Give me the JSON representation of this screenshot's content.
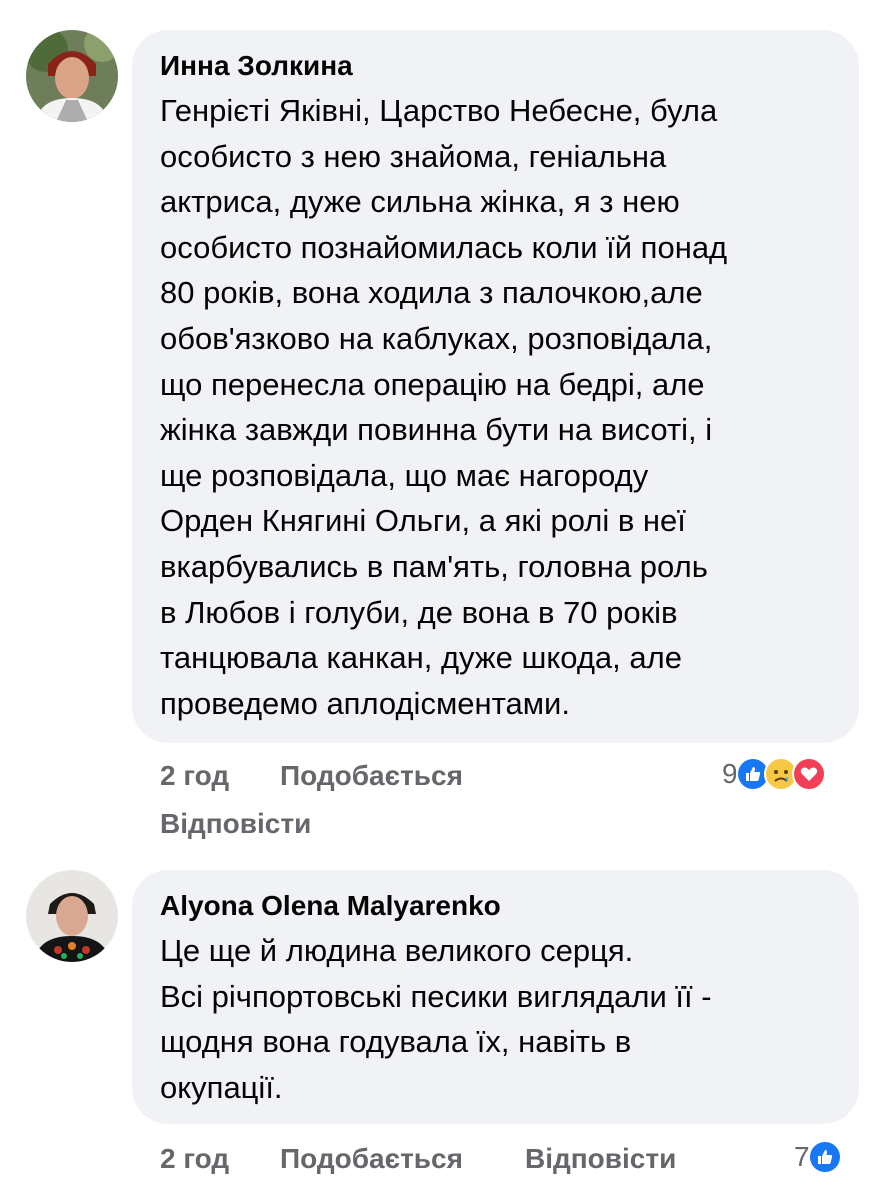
{
  "comments": [
    {
      "author": "Инна Золкина",
      "text": "Генрієті Яківні, Царство Небесне, була\nособисто з нею знайома, геніальна\nактриса, дуже сильна жінка, я з нею\nособисто познайомилась коли їй понад\n80 років, вона ходила з палочкою,але\nобов'язково на каблуках, розповідала,\nщо перенесла операцію на бедрі, але\nжінка завжди повинна бути на висоті, і\nще розповідала, що має нагороду\nОрден Княгині Ольги, а які ролі в неї\nвкарбувались в пам'ять, головна роль\nв Любов і голуби, де вона в 70 років\nтанцювала канкан, дуже шкода, але\nпроведемо аплодісментами.",
      "time": "2 год",
      "like_label": "Подобається",
      "reply_label": "Відповісти",
      "reaction_count": "9",
      "reactions": [
        "like-icon",
        "sad-icon",
        "love-icon"
      ]
    },
    {
      "author": "Alyona Olena Malyarenko",
      "text": "Це ще й людина великого серця.\nВсі річпортовські песики виглядали її -\nщодня вона годувала їх, навіть в\nокупації.",
      "time": "2 год",
      "like_label": "Подобається",
      "reply_label": "Відповісти",
      "reaction_count": "7",
      "reactions": [
        "like-icon"
      ]
    }
  ],
  "colors": {
    "bubble": "#f0f2f5",
    "meta_text": "#65676b",
    "like": "#1877f2",
    "sad": "#f7c845",
    "love": "#f33e58"
  }
}
